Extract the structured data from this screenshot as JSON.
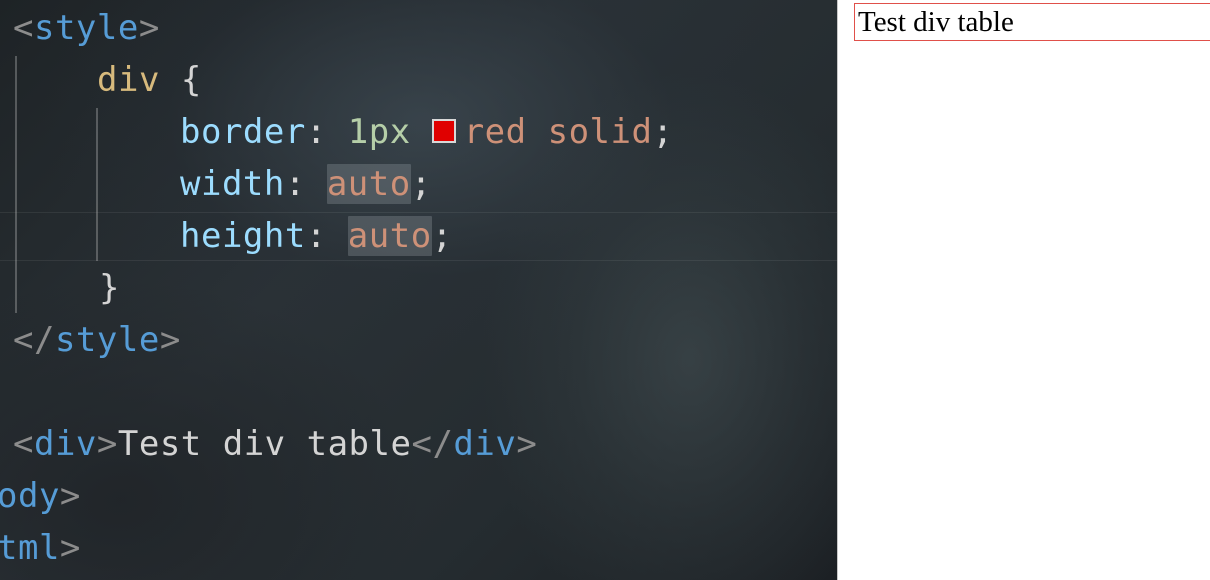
{
  "editor": {
    "tokens": {
      "lt": "<",
      "gt": ">",
      "lt_slash": "</",
      "style_tag": "style",
      "div_selector": "div",
      "open_brace": "{",
      "close_brace": "}",
      "border_prop": "border",
      "width_prop": "width",
      "height_prop": "height",
      "colon": ":",
      "semicolon": ";",
      "border_width": "1px",
      "border_color": "red",
      "border_style": "solid",
      "auto": "auto",
      "div_tag": "div",
      "div_text": "Test div table",
      "body_partial": "ody",
      "html_partial": "tml"
    },
    "swatch_color": "#e00000"
  },
  "preview": {
    "div_text": "Test div table",
    "border_color": "#e0504a"
  }
}
